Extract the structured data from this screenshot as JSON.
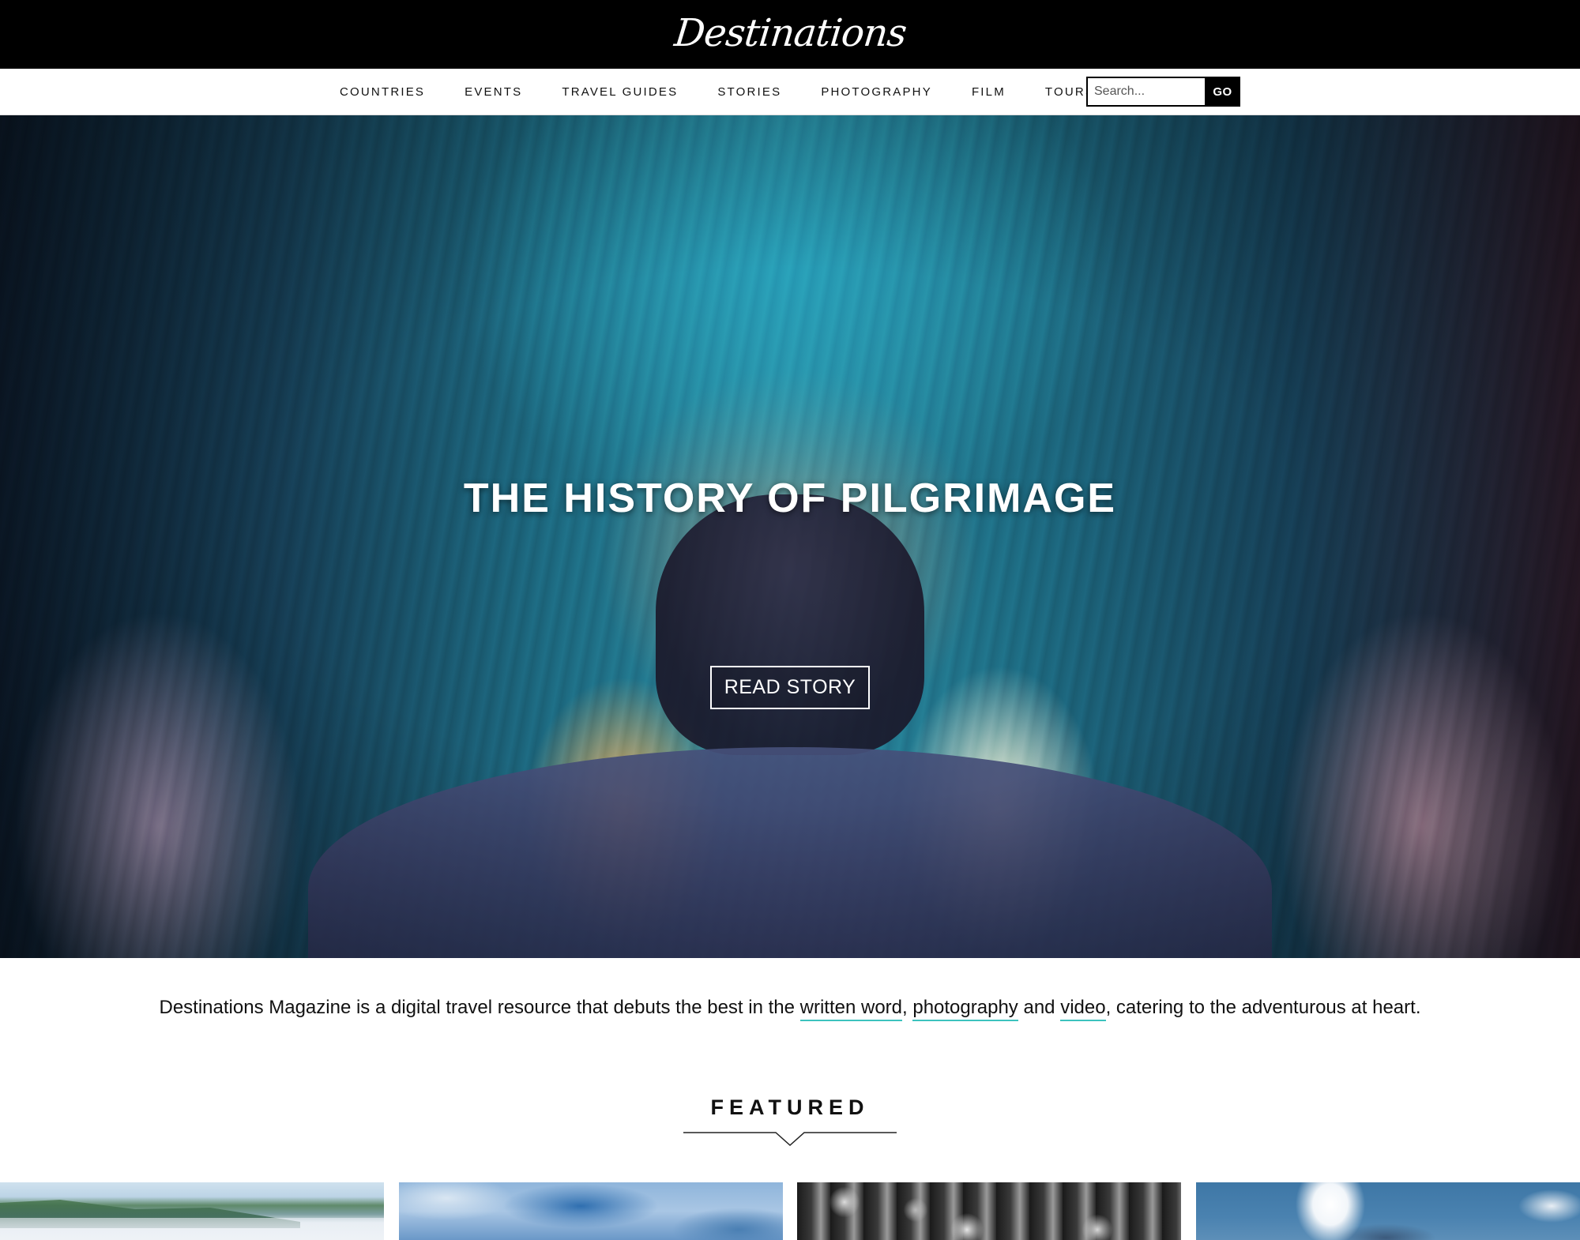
{
  "header": {
    "logo_text": "Destinations"
  },
  "nav": {
    "items": [
      {
        "label": "COUNTRIES"
      },
      {
        "label": "EVENTS"
      },
      {
        "label": "TRAVEL GUIDES"
      },
      {
        "label": "STORIES"
      },
      {
        "label": "PHOTOGRAPHY"
      },
      {
        "label": "FILM"
      },
      {
        "label": "TOURS"
      }
    ],
    "search": {
      "placeholder": "Search...",
      "value": "",
      "button_label": "GO"
    }
  },
  "hero": {
    "title": "THE HISTORY OF PILGRIMAGE",
    "button_label": "READ STORY",
    "image_alt": "Pilgrims inside a painted wooden arched chamber"
  },
  "intro": {
    "text_before": "Destinations Magazine is a digital travel resource that debuts the best in the ",
    "link_written_word": "written word",
    "sep1": ", ",
    "link_photography": "photography",
    "sep2": " and ",
    "link_video": "video",
    "text_after": ", catering to the adventurous at heart.",
    "link_underline_color": "#3cc3be"
  },
  "featured": {
    "title": "FEATURED",
    "cards": [
      {
        "image_alt": "Misty green coastal hills"
      },
      {
        "image_alt": "Blue sky with clouds"
      },
      {
        "image_alt": "Black and white skeleton costumes"
      },
      {
        "image_alt": "Sun shining in a blue sky with clouds"
      }
    ]
  },
  "colors": {
    "header_bg": "#000000",
    "accent": "#3cc3be",
    "text": "#111111"
  }
}
